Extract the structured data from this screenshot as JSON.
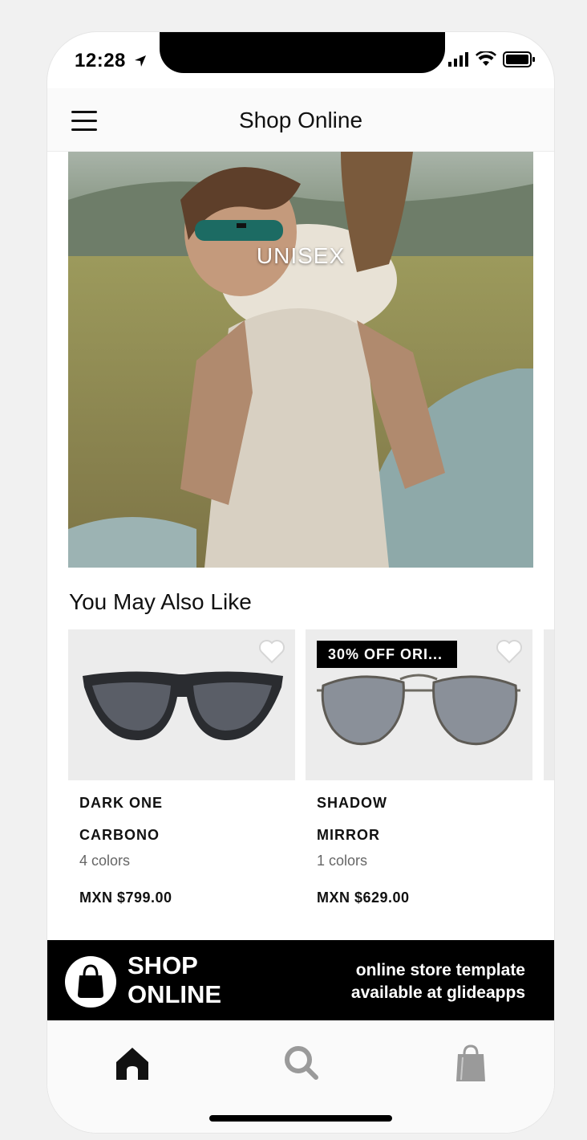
{
  "status_bar": {
    "time": "12:28"
  },
  "header": {
    "title": "Shop Online"
  },
  "hero": {
    "title": "UNISEX"
  },
  "section": {
    "title": "You May Also Like"
  },
  "products": [
    {
      "name_line1": "DARK ONE",
      "name_line2": "CARBONO",
      "colors": "4 colors",
      "price": "MXN $799.00",
      "badge": ""
    },
    {
      "name_line1": "SHADOW",
      "name_line2": "MIRROR",
      "colors": "1 colors",
      "price": "MXN $629.00",
      "badge": "30% OFF ORI..."
    }
  ],
  "promo": {
    "brand_line1": "SHOP",
    "brand_line2": "ONLINE",
    "text_line1": "online store template",
    "text_line2": "available at glideapps"
  },
  "tabs": [
    {
      "icon": "home-icon",
      "active": true
    },
    {
      "icon": "search-icon",
      "active": false
    },
    {
      "icon": "shopping-bag-icon",
      "active": false
    }
  ],
  "colors": {
    "active_tab": "#111111",
    "inactive_tab": "#9a9a9a",
    "banner": "#000000"
  }
}
